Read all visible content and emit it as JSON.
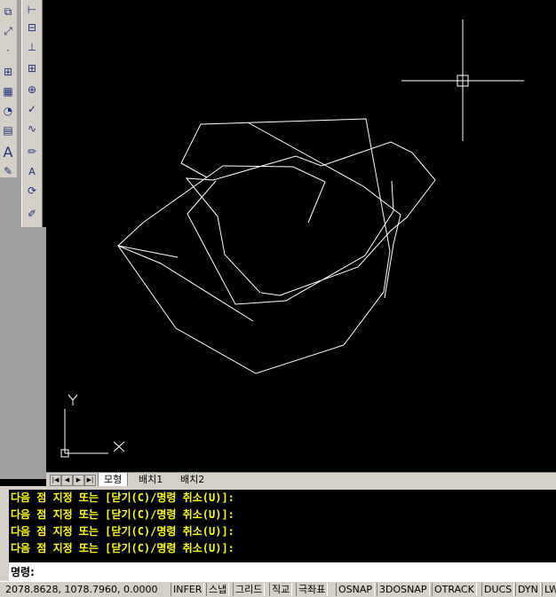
{
  "toolbar_left": [
    "zoom-window-icon",
    "zoom-prev-icon",
    "truck-icon",
    "point-icon",
    "block-icon",
    "hatch-icon",
    "region-icon",
    "table-icon",
    "text-icon",
    "insert-icon"
  ],
  "toolbar_right": [
    "dim-linear-icon",
    "dim-aligned-icon",
    "dim-ordinate-icon",
    "dim-baseline-icon",
    "dim-center-icon",
    "dim-quick-icon",
    "dim-jog-icon",
    "dim-edit-icon",
    "dim-text-icon",
    "dim-update-icon",
    "dim-style-icon"
  ],
  "tabs": {
    "model": "모형",
    "layout1": "배치1",
    "layout2": "배치2"
  },
  "ucs": {
    "x_label": "X",
    "y_label": "Y"
  },
  "command_history": [
    "다음 점 지정 또는 [닫기(C)/명령 취소(U)]:",
    "다음 점 지정 또는 [닫기(C)/명령 취소(U)]:",
    "다음 점 지정 또는 [닫기(C)/명령 취소(U)]:",
    "다음 점 지정 또는 [닫기(C)/명령 취소(U)]:"
  ],
  "command_prompt": "명령:",
  "status": {
    "coords": "2078.8628, 1078.7960, 0.0000",
    "buttons": [
      "INFER",
      "스냅",
      "그리드",
      "직교",
      "극좌표",
      "OSNAP",
      "3DOSNAP",
      "OTRACK",
      "DUCS",
      "DYN",
      "LW"
    ]
  },
  "colors": {
    "canvas": "#000000",
    "lines": "#ffffff",
    "command_text": "#ffff00",
    "ui_gray": "#d4d0c8"
  }
}
